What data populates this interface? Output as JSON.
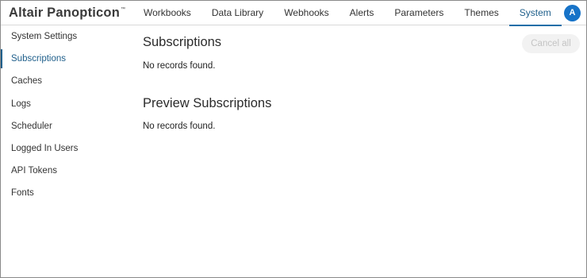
{
  "app": {
    "logo_text": "Altair Panopticon",
    "trademark": "™",
    "avatar_initial": "A"
  },
  "nav": {
    "items": [
      {
        "label": "Workbooks"
      },
      {
        "label": "Data Library"
      },
      {
        "label": "Webhooks"
      },
      {
        "label": "Alerts"
      },
      {
        "label": "Parameters"
      },
      {
        "label": "Themes"
      },
      {
        "label": "System"
      }
    ],
    "active": "System"
  },
  "sidebar": {
    "items": [
      {
        "label": "System Settings"
      },
      {
        "label": "Subscriptions"
      },
      {
        "label": "Caches"
      },
      {
        "label": "Logs"
      },
      {
        "label": "Scheduler"
      },
      {
        "label": "Logged In Users"
      },
      {
        "label": "API Tokens"
      },
      {
        "label": "Fonts"
      }
    ],
    "active": "Subscriptions"
  },
  "main": {
    "subscriptions_title": "Subscriptions",
    "subscriptions_empty": "No records found.",
    "preview_title": "Preview Subscriptions",
    "preview_empty": "No records found.",
    "cancel_all_label": "Cancel all"
  },
  "colors": {
    "accent": "#1f5f8b",
    "avatar_bg": "#1773c8",
    "disabled_button_bg": "#f2f2f2",
    "disabled_button_text": "#c4c4c4"
  }
}
